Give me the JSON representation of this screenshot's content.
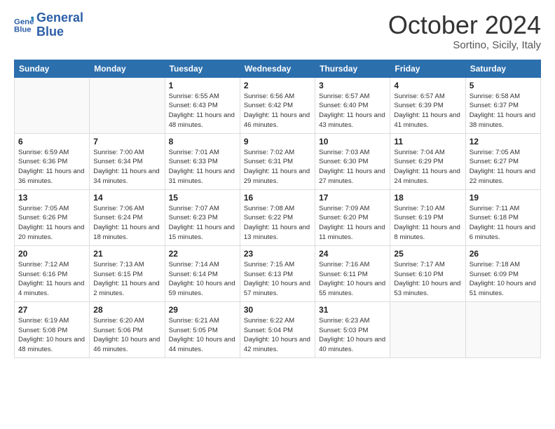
{
  "logo": {
    "line1": "General",
    "line2": "Blue"
  },
  "title": "October 2024",
  "subtitle": "Sortino, Sicily, Italy",
  "headers": [
    "Sunday",
    "Monday",
    "Tuesday",
    "Wednesday",
    "Thursday",
    "Friday",
    "Saturday"
  ],
  "weeks": [
    [
      {
        "day": "",
        "detail": ""
      },
      {
        "day": "",
        "detail": ""
      },
      {
        "day": "1",
        "detail": "Sunrise: 6:55 AM\nSunset: 6:43 PM\nDaylight: 11 hours and 48 minutes."
      },
      {
        "day": "2",
        "detail": "Sunrise: 6:56 AM\nSunset: 6:42 PM\nDaylight: 11 hours and 46 minutes."
      },
      {
        "day": "3",
        "detail": "Sunrise: 6:57 AM\nSunset: 6:40 PM\nDaylight: 11 hours and 43 minutes."
      },
      {
        "day": "4",
        "detail": "Sunrise: 6:57 AM\nSunset: 6:39 PM\nDaylight: 11 hours and 41 minutes."
      },
      {
        "day": "5",
        "detail": "Sunrise: 6:58 AM\nSunset: 6:37 PM\nDaylight: 11 hours and 38 minutes."
      }
    ],
    [
      {
        "day": "6",
        "detail": "Sunrise: 6:59 AM\nSunset: 6:36 PM\nDaylight: 11 hours and 36 minutes."
      },
      {
        "day": "7",
        "detail": "Sunrise: 7:00 AM\nSunset: 6:34 PM\nDaylight: 11 hours and 34 minutes."
      },
      {
        "day": "8",
        "detail": "Sunrise: 7:01 AM\nSunset: 6:33 PM\nDaylight: 11 hours and 31 minutes."
      },
      {
        "day": "9",
        "detail": "Sunrise: 7:02 AM\nSunset: 6:31 PM\nDaylight: 11 hours and 29 minutes."
      },
      {
        "day": "10",
        "detail": "Sunrise: 7:03 AM\nSunset: 6:30 PM\nDaylight: 11 hours and 27 minutes."
      },
      {
        "day": "11",
        "detail": "Sunrise: 7:04 AM\nSunset: 6:29 PM\nDaylight: 11 hours and 24 minutes."
      },
      {
        "day": "12",
        "detail": "Sunrise: 7:05 AM\nSunset: 6:27 PM\nDaylight: 11 hours and 22 minutes."
      }
    ],
    [
      {
        "day": "13",
        "detail": "Sunrise: 7:05 AM\nSunset: 6:26 PM\nDaylight: 11 hours and 20 minutes."
      },
      {
        "day": "14",
        "detail": "Sunrise: 7:06 AM\nSunset: 6:24 PM\nDaylight: 11 hours and 18 minutes."
      },
      {
        "day": "15",
        "detail": "Sunrise: 7:07 AM\nSunset: 6:23 PM\nDaylight: 11 hours and 15 minutes."
      },
      {
        "day": "16",
        "detail": "Sunrise: 7:08 AM\nSunset: 6:22 PM\nDaylight: 11 hours and 13 minutes."
      },
      {
        "day": "17",
        "detail": "Sunrise: 7:09 AM\nSunset: 6:20 PM\nDaylight: 11 hours and 11 minutes."
      },
      {
        "day": "18",
        "detail": "Sunrise: 7:10 AM\nSunset: 6:19 PM\nDaylight: 11 hours and 8 minutes."
      },
      {
        "day": "19",
        "detail": "Sunrise: 7:11 AM\nSunset: 6:18 PM\nDaylight: 11 hours and 6 minutes."
      }
    ],
    [
      {
        "day": "20",
        "detail": "Sunrise: 7:12 AM\nSunset: 6:16 PM\nDaylight: 11 hours and 4 minutes."
      },
      {
        "day": "21",
        "detail": "Sunrise: 7:13 AM\nSunset: 6:15 PM\nDaylight: 11 hours and 2 minutes."
      },
      {
        "day": "22",
        "detail": "Sunrise: 7:14 AM\nSunset: 6:14 PM\nDaylight: 10 hours and 59 minutes."
      },
      {
        "day": "23",
        "detail": "Sunrise: 7:15 AM\nSunset: 6:13 PM\nDaylight: 10 hours and 57 minutes."
      },
      {
        "day": "24",
        "detail": "Sunrise: 7:16 AM\nSunset: 6:11 PM\nDaylight: 10 hours and 55 minutes."
      },
      {
        "day": "25",
        "detail": "Sunrise: 7:17 AM\nSunset: 6:10 PM\nDaylight: 10 hours and 53 minutes."
      },
      {
        "day": "26",
        "detail": "Sunrise: 7:18 AM\nSunset: 6:09 PM\nDaylight: 10 hours and 51 minutes."
      }
    ],
    [
      {
        "day": "27",
        "detail": "Sunrise: 6:19 AM\nSunset: 5:08 PM\nDaylight: 10 hours and 48 minutes."
      },
      {
        "day": "28",
        "detail": "Sunrise: 6:20 AM\nSunset: 5:06 PM\nDaylight: 10 hours and 46 minutes."
      },
      {
        "day": "29",
        "detail": "Sunrise: 6:21 AM\nSunset: 5:05 PM\nDaylight: 10 hours and 44 minutes."
      },
      {
        "day": "30",
        "detail": "Sunrise: 6:22 AM\nSunset: 5:04 PM\nDaylight: 10 hours and 42 minutes."
      },
      {
        "day": "31",
        "detail": "Sunrise: 6:23 AM\nSunset: 5:03 PM\nDaylight: 10 hours and 40 minutes."
      },
      {
        "day": "",
        "detail": ""
      },
      {
        "day": "",
        "detail": ""
      }
    ]
  ]
}
